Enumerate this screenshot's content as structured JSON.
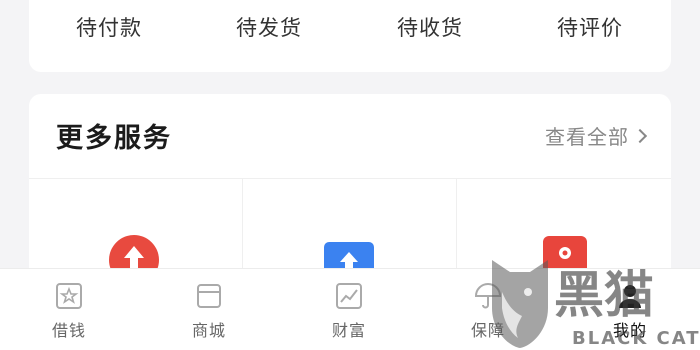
{
  "orders": {
    "tabs": [
      "待付款",
      "待发货",
      "待收货",
      "待评价"
    ]
  },
  "services": {
    "title": "更多服务",
    "view_all": "查看全部",
    "items": [
      {
        "icon": "red-circle-up-arrow-icon",
        "color": "#e84a3f"
      },
      {
        "icon": "blue-upload-icon",
        "color": "#3b82f0"
      },
      {
        "icon": "red-wallet-icon",
        "color": "#e8453c"
      }
    ]
  },
  "tabbar": {
    "items": [
      {
        "label": "借钱",
        "icon": "borrow-icon"
      },
      {
        "label": "商城",
        "icon": "mall-icon"
      },
      {
        "label": "财富",
        "icon": "wealth-icon"
      },
      {
        "label": "保障",
        "icon": "umbrella-icon"
      },
      {
        "label": "我的",
        "icon": "profile-icon",
        "active": true
      }
    ]
  },
  "watermark": {
    "text_cn": "黑猫",
    "text_en": "BLACK CAT"
  }
}
